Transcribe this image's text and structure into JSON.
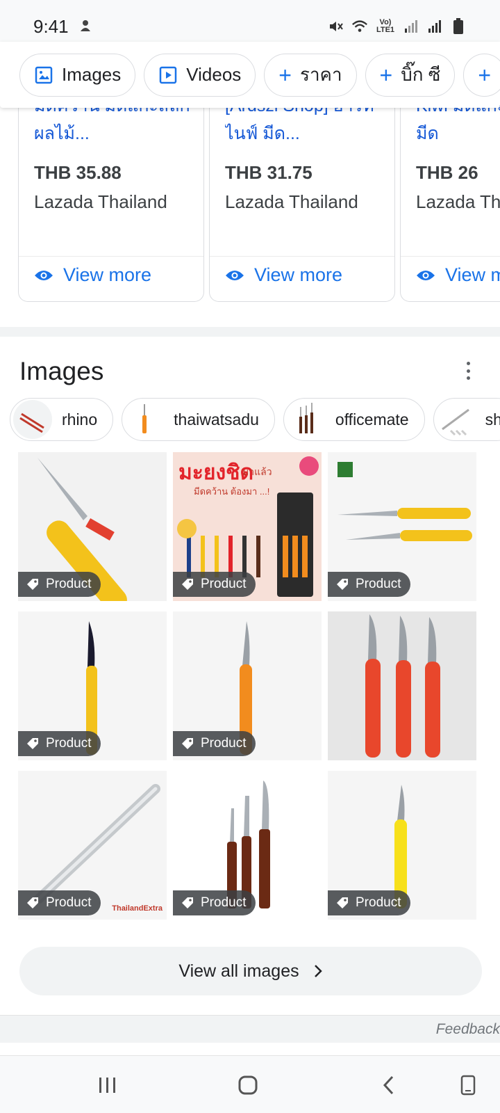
{
  "status": {
    "time": "9:41",
    "lte": "Vo) LTE1"
  },
  "chips": [
    {
      "label": "Images",
      "icon": "image-icon"
    },
    {
      "label": "Videos",
      "icon": "video-icon"
    },
    {
      "label": "ราคา",
      "icon": "plus-icon"
    },
    {
      "label": "บิ๊ก ซี",
      "icon": "plus-icon"
    }
  ],
  "cards": [
    {
      "title": "มีดคว้าน มีดแกะสลักผลไม้...",
      "price": "THB 35.88",
      "store": "Lazada Thailand",
      "view_more": "View more"
    },
    {
      "title": "[Ardszi Shop] อาร์ทไนฟ์ มีด...",
      "price": "THB 31.75",
      "store": "Lazada Thailand",
      "view_more": "View more"
    },
    {
      "title": "Kiwi มีดแกะ มีดคว้าน มีด",
      "price": "THB 26",
      "store": "Lazada Thailand",
      "view_more": "View more"
    }
  ],
  "images": {
    "title": "Images",
    "chips": [
      "rhino",
      "thaiwatsadu",
      "officemate",
      "sh"
    ],
    "tiles": [
      {
        "badge": "Product"
      },
      {
        "badge": "Product",
        "promo_title": "มะยงชิด",
        "promo_sub": "มาแล้ว",
        "promo_line": "มีดคว้าน ต้องมา ...!"
      },
      {
        "badge": "Product"
      },
      {
        "badge": "Product"
      },
      {
        "badge": "Product"
      },
      {
        "badge": ""
      },
      {
        "badge": "Product",
        "watermark": "ThailandExtra"
      },
      {
        "badge": "Product"
      },
      {
        "badge": "Product"
      }
    ],
    "view_all": "View all images"
  },
  "footer": {
    "feedback": "Feedback"
  },
  "colors": {
    "link": "#1a73e8",
    "title_link": "#1558d6",
    "knife_yellow": "#f3c21b",
    "knife_orange": "#f28c1e",
    "knife_red": "#e8472c"
  }
}
